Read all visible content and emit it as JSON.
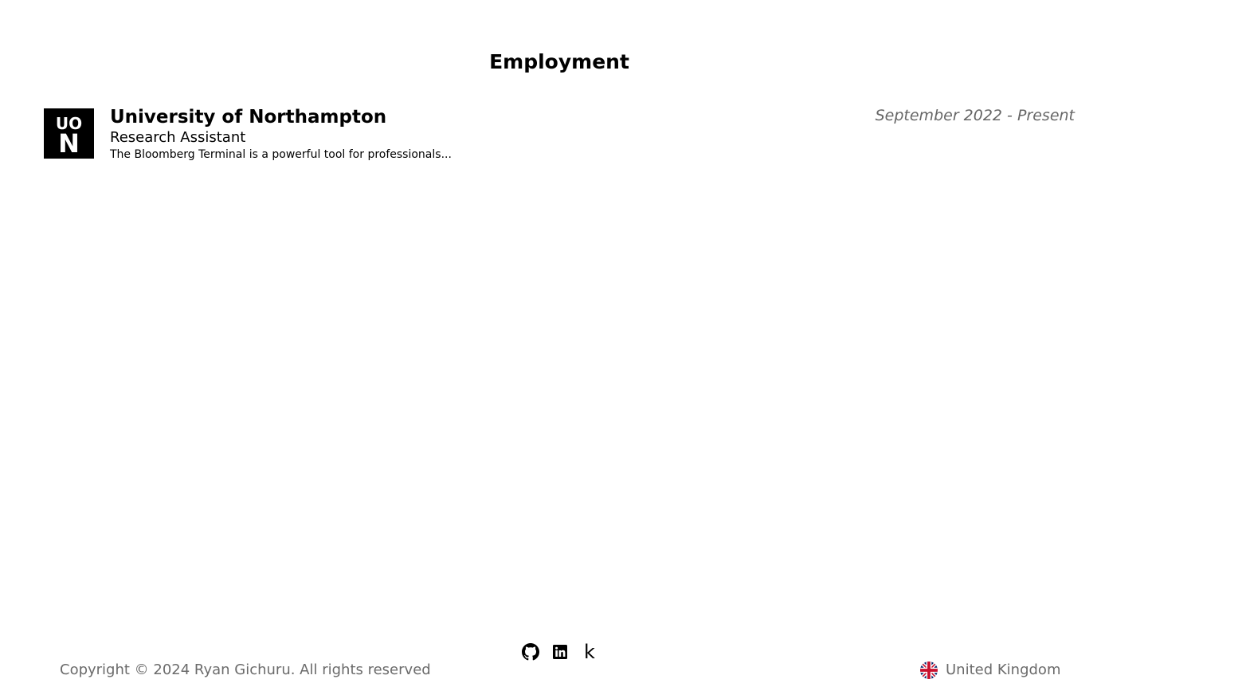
{
  "section": {
    "title": "Employment"
  },
  "employment": [
    {
      "logo_icon": "uon-logo-icon",
      "logo_text_top": "UO",
      "logo_text_bottom": "N",
      "company": "University of Northampton",
      "role": "Research Assistant",
      "description": "The Bloomberg Terminal is a powerful tool for professionals...",
      "dates": "September 2022 - Present"
    }
  ],
  "footer": {
    "copyright": "Copyright © 2024 Ryan Gichuru. All rights reserved",
    "social": [
      {
        "icon": "github-icon"
      },
      {
        "icon": "linkedin-icon"
      },
      {
        "icon": "kaggle-icon",
        "glyph": "k"
      }
    ],
    "locale": {
      "icon": "uk-flag-icon",
      "label": "United Kingdom"
    }
  },
  "colors": {
    "text": "#000000",
    "muted": "#6b6b6b",
    "date": "#666666",
    "background": "#ffffff"
  }
}
